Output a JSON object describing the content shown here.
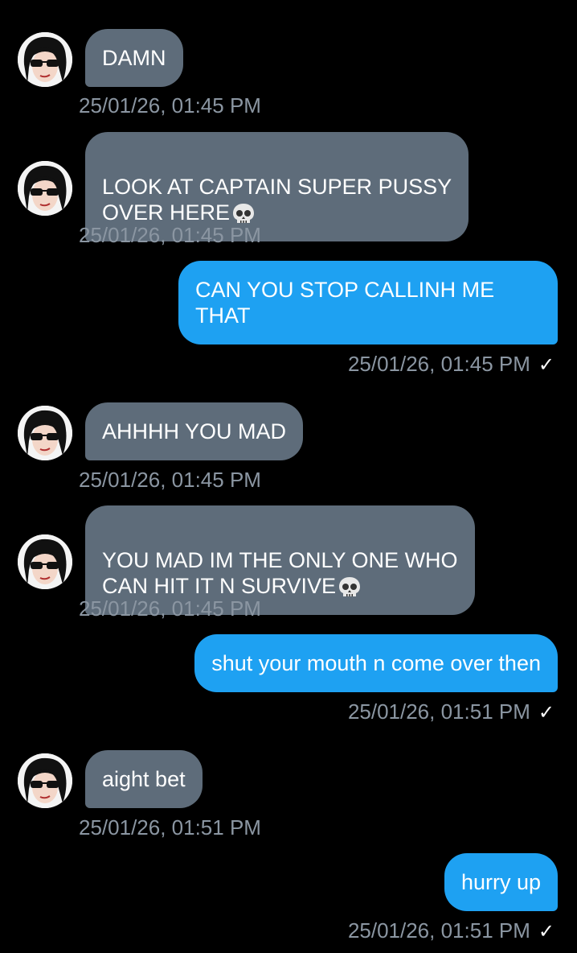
{
  "messages": [
    {
      "dir": "in",
      "text": "DAMN",
      "time": "25/01/26, 01:45 PM"
    },
    {
      "dir": "in",
      "text": "LOOK AT CAPTAIN SUPER PUSSY\nOVER HERE",
      "emoji": "skull-icon",
      "time": "25/01/26, 01:45 PM"
    },
    {
      "dir": "out",
      "text": "CAN YOU STOP CALLINH ME\nTHAT",
      "time": "25/01/26, 01:45 PM",
      "status": "✓"
    },
    {
      "dir": "in",
      "text": "AHHHH YOU MAD",
      "time": "25/01/26, 01:45 PM"
    },
    {
      "dir": "in",
      "text": "YOU MAD IM THE ONLY ONE WHO\nCAN HIT IT N SURVIVE",
      "emoji": "skull-icon",
      "time": "25/01/26, 01:45 PM"
    },
    {
      "dir": "out",
      "text": "shut your mouth n come over then",
      "time": "25/01/26, 01:51 PM",
      "status": "✓"
    },
    {
      "dir": "in",
      "text": "aight bet",
      "time": "25/01/26, 01:51 PM"
    },
    {
      "dir": "out",
      "text": "hurry up",
      "time": "25/01/26, 01:51 PM",
      "status": "✓"
    }
  ],
  "colors": {
    "background": "#000000",
    "incoming_bubble": "#5e6c7a",
    "outgoing_bubble": "#1ea1f2",
    "timestamp": "#8b96a2"
  }
}
